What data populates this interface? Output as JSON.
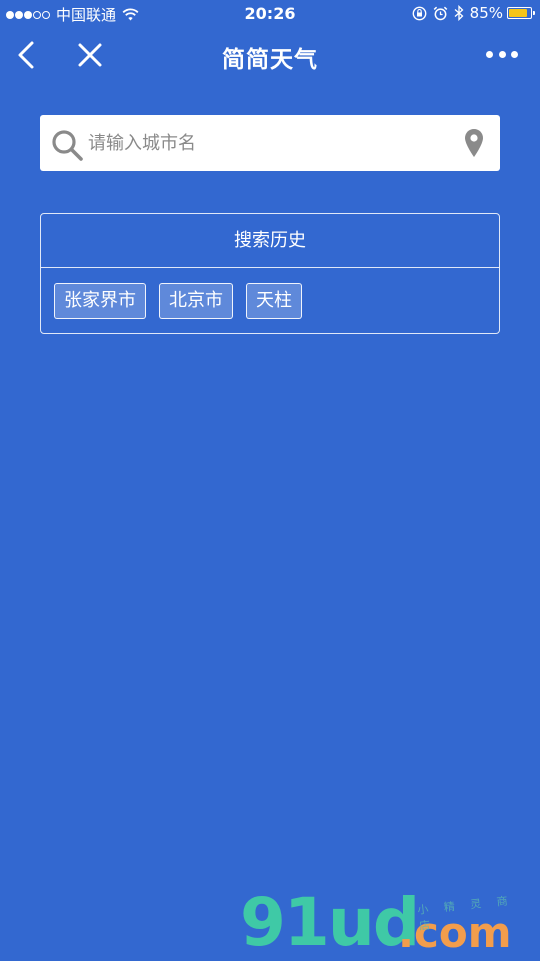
{
  "status_bar": {
    "signal_full": 3,
    "signal_empty": 2,
    "carrier": "中国联通",
    "time": "20:26",
    "battery_percent": "85%",
    "battery_level": 0.85,
    "battery_color": "#f5c518"
  },
  "nav": {
    "title": "简简天气",
    "back_icon": "chevron-left-icon",
    "close_icon": "close-icon",
    "more_icon": "more-dots-icon"
  },
  "search": {
    "placeholder": "请输入城市名",
    "value": ""
  },
  "history": {
    "title": "搜索历史",
    "tags": [
      {
        "label": "张家界市"
      },
      {
        "label": "北京市"
      },
      {
        "label": "天柱"
      }
    ]
  },
  "watermark": {
    "main": "91ud",
    "suffix": ".com",
    "sub": "小 精 灵 商 店"
  },
  "colors": {
    "background": "#3368d0",
    "search_bg": "#ffffff",
    "placeholder": "#8a8a8a",
    "icon_gray": "#8a8a8a"
  }
}
